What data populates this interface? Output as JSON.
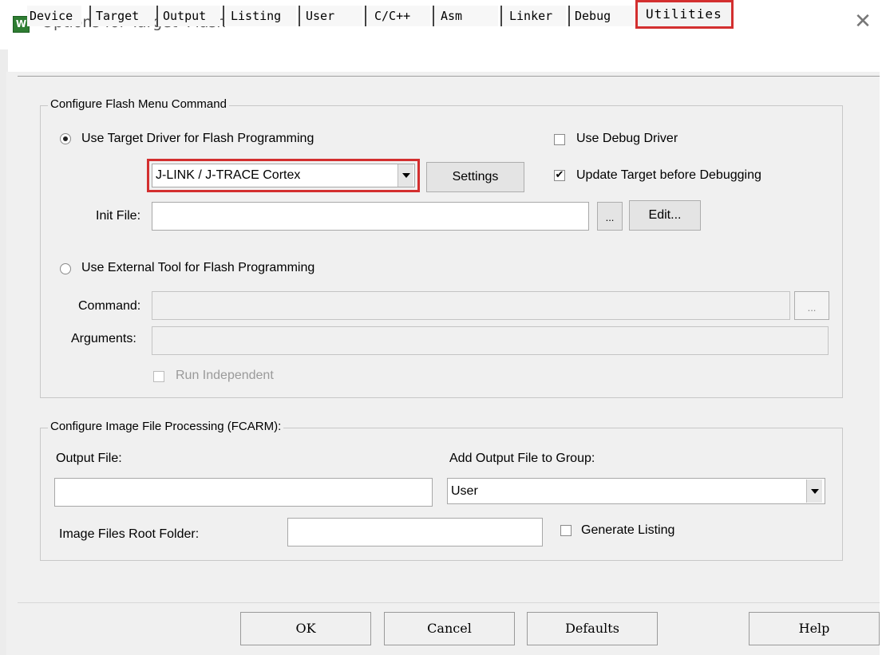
{
  "window": {
    "title": "Options for Target 'Flash'",
    "icon": "keil-uvision-icon",
    "close_glyph": "✕"
  },
  "tabs": [
    {
      "label": "Device"
    },
    {
      "label": "Target"
    },
    {
      "label": "Output"
    },
    {
      "label": "Listing"
    },
    {
      "label": "User"
    },
    {
      "label": "C/C++"
    },
    {
      "label": "Asm"
    },
    {
      "label": "Linker"
    },
    {
      "label": "Debug"
    },
    {
      "label": "Utilities",
      "active": true
    }
  ],
  "flash_menu": {
    "legend": "Configure Flash Menu Command",
    "use_target_driver_label": "Use Target Driver for Flash Programming",
    "use_target_driver_selected": true,
    "driver_value": "J-LINK / J-TRACE Cortex",
    "settings_label": "Settings",
    "use_debug_driver_label": "Use Debug Driver",
    "use_debug_driver_checked": false,
    "update_target_label": "Update Target before Debugging",
    "update_target_checked": true,
    "init_file_label": "Init File:",
    "init_file_value": "",
    "browse_label": "...",
    "edit_label": "Edit...",
    "use_external_label": "Use External Tool for Flash Programming",
    "use_external_selected": false,
    "command_label": "Command:",
    "command_value": "",
    "command_browse_label": "...",
    "arguments_label": "Arguments:",
    "arguments_value": "",
    "run_independent_label": "Run Independent",
    "run_independent_checked": false
  },
  "image_processing": {
    "legend": "Configure Image File Processing (FCARM):",
    "output_file_label": "Output File:",
    "output_file_value": "",
    "add_to_group_label": "Add Output File  to Group:",
    "group_value": "User",
    "root_folder_label": "Image Files Root Folder:",
    "root_folder_value": "",
    "generate_listing_label": "Generate Listing",
    "generate_listing_checked": false
  },
  "buttons": {
    "ok": "OK",
    "cancel": "Cancel",
    "defaults": "Defaults",
    "help": "Help"
  },
  "colors": {
    "highlight": "#d32f2f",
    "dialog_bg": "#f0f0f0"
  }
}
